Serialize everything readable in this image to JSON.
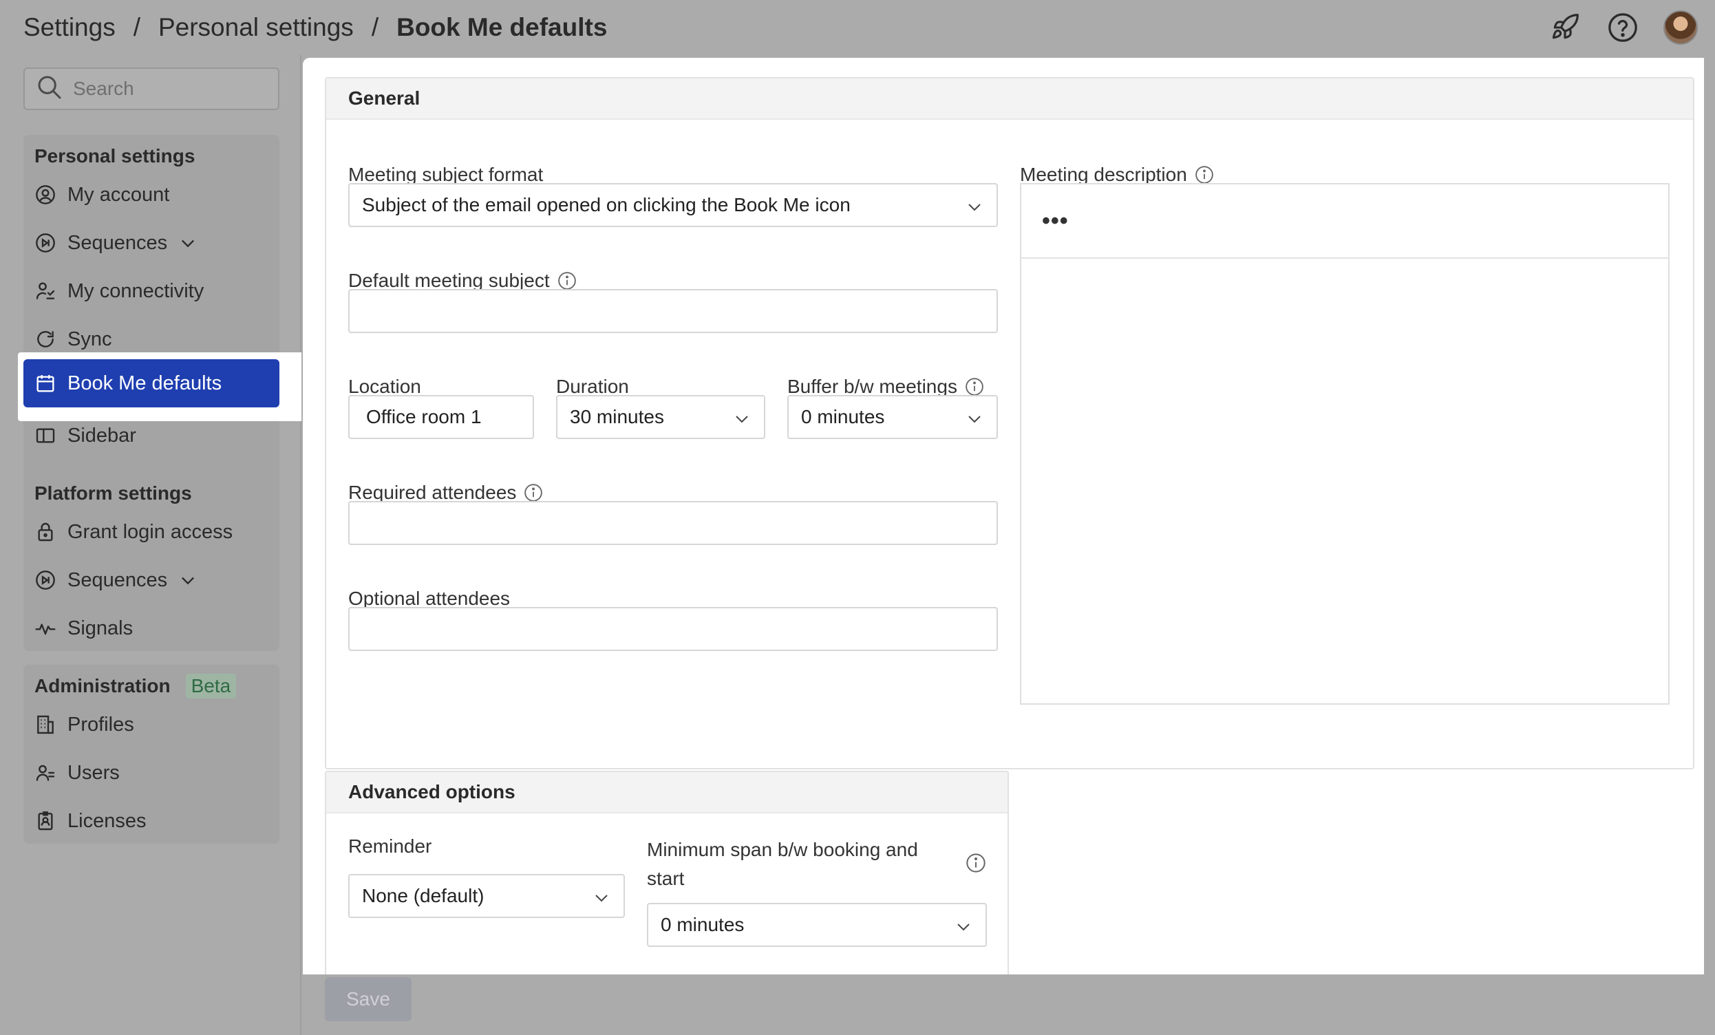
{
  "breadcrumb": {
    "items": [
      "Settings",
      "Personal settings",
      "Book Me defaults"
    ],
    "separator": "/"
  },
  "header_icons": [
    "rocket-icon",
    "help-icon",
    "avatar"
  ],
  "sidebar": {
    "search_placeholder": "Search",
    "groups": [
      {
        "title": "Personal settings",
        "items": [
          {
            "label": "My account",
            "icon": "user-circle-icon"
          },
          {
            "label": "Sequences",
            "icon": "sequences-icon",
            "expandable": true
          },
          {
            "label": "My connectivity",
            "icon": "connectivity-icon"
          },
          {
            "label": "Sync",
            "icon": "sync-icon"
          },
          {
            "label": "Book Me defaults",
            "icon": "calendar-icon",
            "active": true
          },
          {
            "label": "Sidebar",
            "icon": "sidebar-icon"
          }
        ]
      },
      {
        "title": "Platform settings",
        "items": [
          {
            "label": "Grant login access",
            "icon": "lock-icon"
          },
          {
            "label": "Sequences",
            "icon": "sequences-icon",
            "expandable": true
          },
          {
            "label": "Signals",
            "icon": "signals-icon"
          }
        ]
      },
      {
        "title": "Administration",
        "badge": "Beta",
        "items": [
          {
            "label": "Profiles",
            "icon": "building-icon"
          },
          {
            "label": "Users",
            "icon": "users-icon"
          },
          {
            "label": "Licenses",
            "icon": "license-icon"
          }
        ]
      }
    ]
  },
  "general": {
    "title": "General",
    "meeting_subject_format": {
      "label": "Meeting subject format",
      "value": "Subject of the email opened on clicking the Book Me icon"
    },
    "default_meeting_subject": {
      "label": "Default meeting subject",
      "value": ""
    },
    "location": {
      "label": "Location",
      "value": "Office room 1"
    },
    "duration": {
      "label": "Duration",
      "value": "30 minutes"
    },
    "buffer": {
      "label": "Buffer b/w meetings",
      "value": "0 minutes"
    },
    "required_attendees": {
      "label": "Required attendees",
      "value": ""
    },
    "optional_attendees": {
      "label": "Optional attendees",
      "value": ""
    },
    "meeting_description": {
      "label": "Meeting description",
      "toolbar": "•••"
    }
  },
  "advanced": {
    "title": "Advanced options",
    "reminder": {
      "label": "Reminder",
      "value": "None (default)"
    },
    "min_span": {
      "label_line1": "Minimum span b/w booking and",
      "label_line2": "start",
      "value": "0 minutes"
    }
  },
  "save_label": "Save",
  "colors": {
    "accent": "#1f3fb0",
    "overlay": "#ababab",
    "beta": "#2f6b44"
  }
}
